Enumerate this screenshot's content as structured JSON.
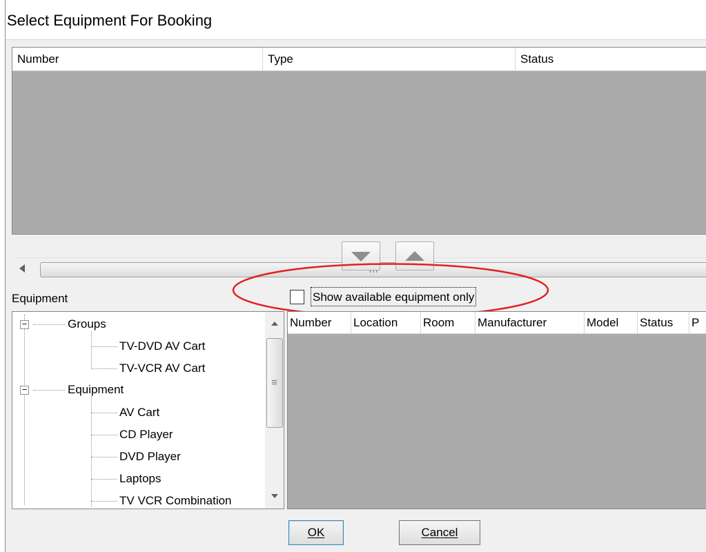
{
  "window": {
    "title": "Select Equipment For Booking"
  },
  "selected_list": {
    "columns": [
      "Number",
      "Type",
      "Status"
    ],
    "rows": [],
    "hscroll_grip": "III"
  },
  "move_buttons": {
    "down_icon": "arrow-down",
    "up_icon": "arrow-up"
  },
  "equipment_label": "Equipment",
  "filter": {
    "label": "Show available equipment only",
    "checked": false,
    "highlight_color": "#e02020"
  },
  "tree": {
    "scroll_grip": "≡",
    "groups": [
      {
        "label": "Groups",
        "expander": "−",
        "children": [
          "TV-DVD AV Cart",
          "TV-VCR AV Cart"
        ]
      },
      {
        "label": "Equipment",
        "expander": "−",
        "children": [
          "AV Cart",
          "CD Player",
          "DVD Player",
          "Laptops",
          "TV VCR Combination"
        ]
      }
    ]
  },
  "available_list": {
    "columns": [
      "Number",
      "Location",
      "Room",
      "Manufacturer",
      "Model",
      "Status",
      "P"
    ],
    "rows": []
  },
  "buttons": {
    "ok": "OK",
    "cancel": "Cancel"
  }
}
